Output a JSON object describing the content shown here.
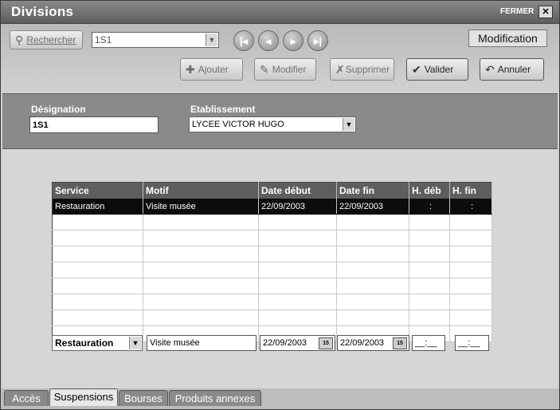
{
  "window": {
    "title": "Divisions",
    "close_label": "FERMER",
    "close_glyph": "✕"
  },
  "toolbar": {
    "search_label": "Rechercher",
    "search_combo_value": "1S1",
    "mode_label": "Modification",
    "add_label": "Ajouter",
    "edit_label": "Modifier",
    "delete_label": "Supprimer",
    "validate_label": "Valider",
    "cancel_label": "Annuler"
  },
  "header": {
    "designation_label": "Désignation",
    "designation_value": "1S1",
    "establishment_label": "Etablissement",
    "establishment_value": "LYCEE VICTOR HUGO"
  },
  "grid": {
    "columns": [
      "Service",
      "Motif",
      "Date début",
      "Date fin",
      "H. déb",
      "H. fin"
    ],
    "rows": [
      [
        "Restauration",
        "Visite musée",
        "22/09/2003",
        "22/09/2003",
        ":",
        ":"
      ]
    ]
  },
  "editor": {
    "service_value": "Restauration",
    "motif_value": "Visite musée",
    "date_start_value": "22/09/2003",
    "date_end_value": "22/09/2003",
    "hour_start_value": "__:__",
    "hour_end_value": "__:__",
    "calendar_glyph": "15"
  },
  "tabs": [
    {
      "label": "Accès",
      "active": false
    },
    {
      "label": "Suspensions",
      "active": true
    },
    {
      "label": "Bourses",
      "active": false
    },
    {
      "label": "Produits annexes",
      "active": false
    }
  ]
}
